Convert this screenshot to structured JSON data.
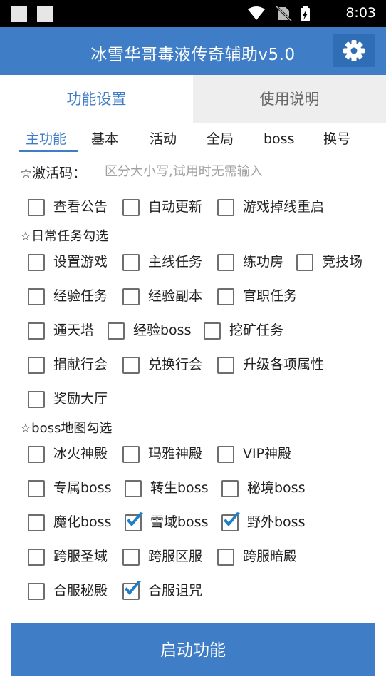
{
  "status_bar": {
    "time": "8:03"
  },
  "app_bar": {
    "title": "冰雪华哥毒液传奇辅助v5.0"
  },
  "tabs": [
    {
      "label": "功能设置",
      "active": true
    },
    {
      "label": "使用说明",
      "active": false
    }
  ],
  "sub_tabs": [
    {
      "label": "主功能",
      "active": true
    },
    {
      "label": "基本"
    },
    {
      "label": "活动"
    },
    {
      "label": "全局"
    },
    {
      "label": "boss"
    },
    {
      "label": "换号"
    }
  ],
  "activation": {
    "label": "☆激活码：",
    "placeholder": "区分大小写,试用时无需输入",
    "value": ""
  },
  "general_options": [
    {
      "label": "查看公告",
      "checked": false
    },
    {
      "label": "自动更新",
      "checked": false
    },
    {
      "label": "游戏掉线重启",
      "checked": false
    }
  ],
  "daily_section": {
    "header": "☆日常任务勾选",
    "items": [
      {
        "label": "设置游戏",
        "checked": false
      },
      {
        "label": "主线任务",
        "checked": false
      },
      {
        "label": "练功房",
        "checked": false
      },
      {
        "label": "竞技场",
        "checked": false
      },
      {
        "label": "经验任务",
        "checked": false
      },
      {
        "label": "经验副本",
        "checked": false
      },
      {
        "label": "官职任务",
        "checked": false
      },
      {
        "label": "通天塔",
        "checked": false
      },
      {
        "label": "经验boss",
        "checked": false
      },
      {
        "label": "挖矿任务",
        "checked": false
      },
      {
        "label": "捐献行会",
        "checked": false
      },
      {
        "label": "兑换行会",
        "checked": false
      },
      {
        "label": "升级各项属性",
        "checked": false
      },
      {
        "label": "奖励大厅",
        "checked": false
      }
    ]
  },
  "boss_section": {
    "header": "☆boss地图勾选",
    "items": [
      {
        "label": "冰火神殿",
        "checked": false
      },
      {
        "label": "玛雅神殿",
        "checked": false
      },
      {
        "label": "VIP神殿",
        "checked": false
      },
      {
        "label": "专属boss",
        "checked": false
      },
      {
        "label": "转生boss",
        "checked": false
      },
      {
        "label": "秘境boss",
        "checked": false
      },
      {
        "label": "魔化boss",
        "checked": false
      },
      {
        "label": "雪域boss",
        "checked": true
      },
      {
        "label": "野外boss",
        "checked": true
      },
      {
        "label": "跨服圣域",
        "checked": false
      },
      {
        "label": "跨服区服",
        "checked": false
      },
      {
        "label": "跨服暗殿",
        "checked": false
      },
      {
        "label": "合服秘殿",
        "checked": false
      },
      {
        "label": "合服诅咒",
        "checked": true
      }
    ]
  },
  "start_button": {
    "label": "启动功能"
  },
  "colors": {
    "primary": "#3f7ec6",
    "status_bar": "#000000",
    "check": "#1f7ec8"
  },
  "icons": [
    "settings-gear-icon",
    "wifi-icon",
    "no-sim-icon",
    "battery-charging-icon",
    "checkmark-icon"
  ]
}
